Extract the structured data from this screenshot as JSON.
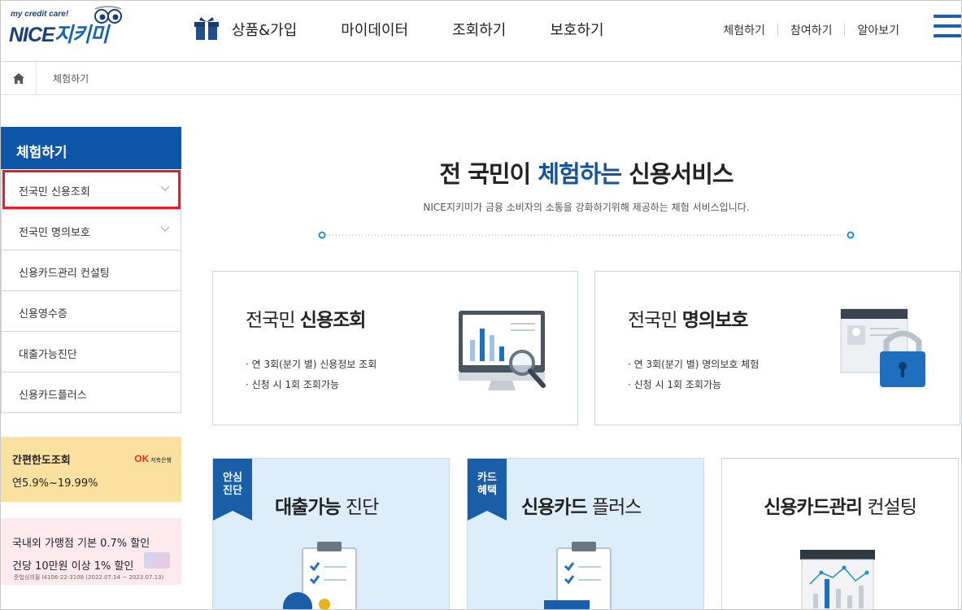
{
  "header": {
    "logo": {
      "tagline": "my credit care!",
      "brand_en": "NICE",
      "brand_ko": "지키미"
    },
    "nav": [
      "상품&가입",
      "마이데이터",
      "조회하기",
      "보호하기"
    ],
    "util": [
      "체험하기",
      "참여하기",
      "알아보기"
    ]
  },
  "breadcrumb": {
    "current": "체험하기"
  },
  "sidebar": {
    "title": "체험하기",
    "items": [
      {
        "label": "전국민 신용조회"
      },
      {
        "label": "전국민 명의보호"
      },
      {
        "label": "신용카드관리 컨설팅"
      },
      {
        "label": "신용영수증"
      },
      {
        "label": "대출가능진단"
      },
      {
        "label": "신용카드플러스"
      }
    ]
  },
  "ads": {
    "loan": {
      "title": "간편한도조회",
      "rate": "연5.9%~19.99%",
      "brand": "OK",
      "brand_sub": "저축은행"
    },
    "card": {
      "line1": "국내외 가맹점 기본 0.7% 할인",
      "line2": "건당 10만원 이상 1% 할인",
      "notice": "준법심의필 I4106-22-3108 (2022.07.14 ~ 2023.07.13)"
    }
  },
  "hero": {
    "title_pre": "전 국민이 ",
    "title_em": "체험하는",
    "title_post": " 신용서비스",
    "subtitle": "NICE지키미가 금융 소비자의 소통을 강화하기위해 제공하는 체험 서비스입니다."
  },
  "cards": [
    {
      "title_light": "전국민 ",
      "title_bold": "신용조회",
      "lines": [
        "· 연 3회(분기 별) 신용정보 조회",
        "· 신청 시 1회 조회가능"
      ]
    },
    {
      "title_light": "전국민 ",
      "title_bold": "명의보호",
      "lines": [
        "· 연 3회(분기 별) 명의보호 체험",
        "· 신청 시 1회 조회가능"
      ]
    }
  ],
  "tiles": [
    {
      "ribbon": [
        "안심",
        "진단"
      ],
      "title_bold": "대출가능",
      "title_light": " 진단"
    },
    {
      "ribbon": [
        "카드",
        "혜택"
      ],
      "title_bold": "신용카드",
      "title_light": " 플러스"
    },
    {
      "title_bold": "신용카드관리",
      "title_light": " 컨설팅"
    }
  ],
  "colors": {
    "primary": "#0d56a8",
    "accent": "#13549c",
    "highlight_border": "#e01e2e",
    "tile_bg": "#ddeefa"
  }
}
